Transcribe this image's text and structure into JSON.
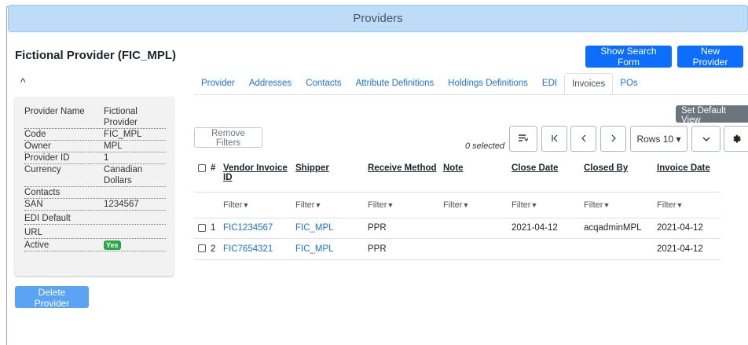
{
  "header": {
    "title": "Providers"
  },
  "provider": {
    "title": "Fictional Provider (FIC_MPL)"
  },
  "actions": {
    "show_search_form": "Show Search Form",
    "new_provider": "New Provider",
    "delete_provider": "Delete Provider"
  },
  "details": {
    "collapse_icon": "^",
    "rows": [
      {
        "label": "Provider Name",
        "value": "Fictional Provider"
      },
      {
        "label": "Code",
        "value": "FIC_MPL"
      },
      {
        "label": "Owner",
        "value": "MPL"
      },
      {
        "label": "Provider ID",
        "value": "1"
      },
      {
        "label": "Currency",
        "value": "Canadian Dollars"
      },
      {
        "label": "Contacts",
        "value": ""
      },
      {
        "label": "SAN",
        "value": "1234567"
      },
      {
        "label": "EDI Default",
        "value": ""
      },
      {
        "label": "URL",
        "value": ""
      },
      {
        "label": "Active",
        "value": "Yes"
      }
    ]
  },
  "tabs": [
    "Provider",
    "Addresses",
    "Contacts",
    "Attribute Definitions",
    "Holdings Definitions",
    "EDI",
    "Invoices",
    "POs"
  ],
  "active_tab": "Invoices",
  "toolbar": {
    "set_default_view": "Set Default View",
    "remove_filters": "Remove Filters",
    "selected": "0 selected",
    "rows_label": "Rows 10 ▾",
    "icons": [
      "column-toggle-icon",
      "first-page-icon",
      "prev-page-icon",
      "next-page-icon",
      "chevron-down-icon",
      "gear-icon"
    ]
  },
  "table": {
    "columns": [
      "#",
      "Vendor Invoice ID",
      "Shipper",
      "Receive Method",
      "Note",
      "Close Date",
      "Closed By",
      "Invoice Date"
    ],
    "filter_label": "Filter",
    "rows": [
      {
        "num": "1",
        "vendor_invoice_id": "FIC1234567",
        "shipper": "FIC_MPL",
        "receive_method": "PPR",
        "note": "",
        "close_date": "2021-04-12",
        "closed_by": "acqadminMPL",
        "invoice_date": "2021-04-12"
      },
      {
        "num": "2",
        "vendor_invoice_id": "FIC7654321",
        "shipper": "FIC_MPL",
        "receive_method": "PPR",
        "note": "",
        "close_date": "",
        "closed_by": "",
        "invoice_date": "2021-04-12"
      }
    ]
  },
  "colors": {
    "primary": "#0d6efd",
    "title_bar": "#bcdcf8",
    "link": "#1a73e8",
    "active_badge": "#28a745",
    "secondary": "#6c757d"
  }
}
